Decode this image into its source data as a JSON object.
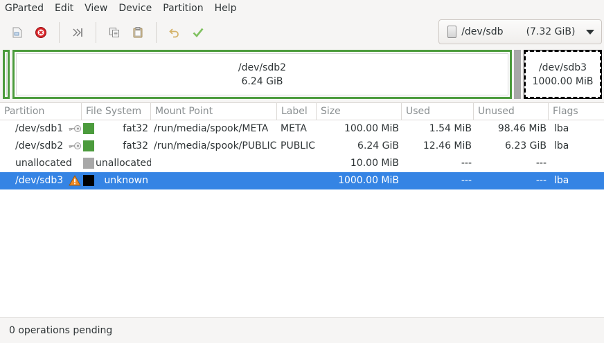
{
  "menubar": {
    "items": [
      "GParted",
      "Edit",
      "View",
      "Device",
      "Partition",
      "Help"
    ]
  },
  "toolbar": {
    "buttons": [
      "new-icon",
      "delete-icon",
      "resize-icon",
      "copy-icon",
      "paste-icon",
      "undo-icon",
      "apply-icon"
    ],
    "device": {
      "name": "/dev/sdb",
      "size": "(7.32 GiB)"
    }
  },
  "map": {
    "sdb2": {
      "name": "/dev/sdb2",
      "size": "6.24 GiB"
    },
    "sdb3": {
      "name": "/dev/sdb3",
      "size": "1000.00 MiB"
    }
  },
  "table": {
    "headers": [
      "Partition",
      "File System",
      "Mount Point",
      "Label",
      "Size",
      "Used",
      "Unused",
      "Flags"
    ],
    "rows": [
      {
        "partition": "/dev/sdb1",
        "icon": "key-icon",
        "fs_color": "#4b9b3c",
        "filesystem": "fat32",
        "mount": "/run/media/spook/META",
        "label": "META",
        "size": "100.00 MiB",
        "used": "1.54 MiB",
        "unused": "98.46 MiB",
        "flags": "lba"
      },
      {
        "partition": "/dev/sdb2",
        "icon": "key-icon",
        "fs_color": "#4b9b3c",
        "filesystem": "fat32",
        "mount": "/run/media/spook/PUBLIC",
        "label": "PUBLIC",
        "size": "6.24 GiB",
        "used": "12.46 MiB",
        "unused": "6.23 GiB",
        "flags": "lba"
      },
      {
        "partition": "unallocated",
        "icon": "",
        "fs_color": "#a8a8a8",
        "filesystem": "unallocated",
        "mount": "",
        "label": "",
        "size": "10.00 MiB",
        "used": "---",
        "unused": "---",
        "flags": ""
      },
      {
        "partition": "/dev/sdb3",
        "icon": "warning-icon",
        "fs_color": "#000000",
        "filesystem": "unknown",
        "mount": "",
        "label": "",
        "size": "1000.00 MiB",
        "used": "---",
        "unused": "---",
        "flags": "lba"
      }
    ],
    "selected_row": 3
  },
  "status": {
    "text": "0 operations pending"
  }
}
